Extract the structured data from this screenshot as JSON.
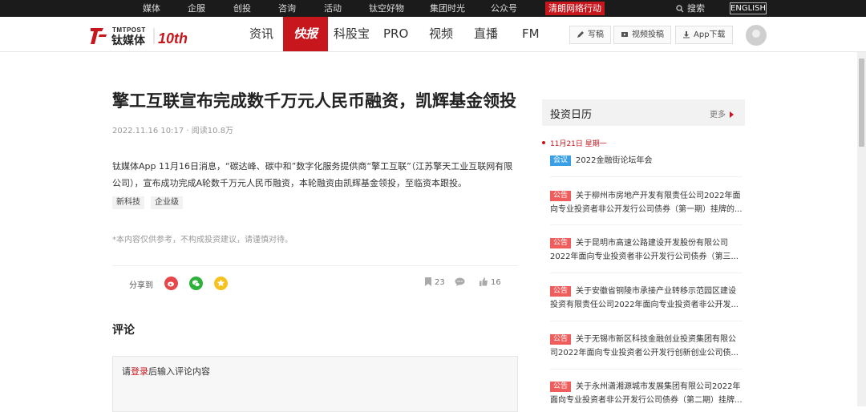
{
  "topbar": {
    "links": [
      "媒体",
      "企服",
      "创投",
      "咨询",
      "活动",
      "钛空好物",
      "集团时光",
      "公众号"
    ],
    "highlight": "清朗网络行动",
    "search_label": "搜索",
    "english_label": "ENGLISH"
  },
  "logo": {
    "en": "TMTPOST",
    "cn": "钛媒体",
    "anniv": "10th"
  },
  "nav": {
    "items": [
      "资讯",
      "快报",
      "科股宝",
      "PRO",
      "视频",
      "直播",
      "FM"
    ],
    "active": "快报",
    "write_label": "写稿",
    "video_label": "视频投稿",
    "app_label": "App下载"
  },
  "article": {
    "title": "擎工互联宣布完成数千万元人民币融资，凯辉基金领投",
    "meta": "2022.11.16 10:17 · 阅读10.8万",
    "body": "钛媒体App 11月16日消息，“碳达峰、碳中和”数字化服务提供商“擎工互联”（江苏擎天工业互联网有限公司），宣布成功完成A轮数千万元人民币融资，本轮融资由凯辉基金领投，至临资本跟投。",
    "tags": [
      "新科技",
      "企业级"
    ],
    "disclaimer": "*本内容仅供参考，不构成投资建议，请谨慎对待。",
    "share_label": "分享到",
    "bookmark_count": "23",
    "like_count": "16"
  },
  "comments": {
    "heading": "评论",
    "placeholder_pre": "请",
    "placeholder_login": "登录",
    "placeholder_post": "后输入评论内容"
  },
  "calendar": {
    "heading": "投资日历",
    "more_label": "更多",
    "date_label": "11月21日  星期一",
    "items": [
      {
        "badge": "会议",
        "type": "meet",
        "text": "2022金融街论坛年会"
      },
      {
        "badge": "公告",
        "type": "notice",
        "text": "关于柳州市房地产开发有限责任公司2022年面向专业投资者非公开发行公司债券（第一期）挂牌的..."
      },
      {
        "badge": "公告",
        "type": "notice",
        "text": "关于昆明市高速公路建设开发股份有限公司2022年面向专业投资者非公开发行公司债券（第三..."
      },
      {
        "badge": "公告",
        "type": "notice",
        "text": "关于安徽省铜陵市承接产业转移示范园区建设投资有限责任公司2022年面向专业投资者非公开发..."
      },
      {
        "badge": "公告",
        "type": "notice",
        "text": "关于无锡市新区科技金融创业投资集团有限公司2022年面向专业投资者公开发行创新创业公司债..."
      },
      {
        "badge": "公告",
        "type": "notice",
        "text": "关于永州潇湘源城市发展集团有限公司2022年面向专业投资者非公开发行公司债券（第二期）挂牌..."
      }
    ]
  },
  "colors": {
    "brand_red": "#c8161d",
    "topbar": "#1b1b1b",
    "meet_blue": "#3aa0e6",
    "notice_red": "#ef5d5d"
  }
}
